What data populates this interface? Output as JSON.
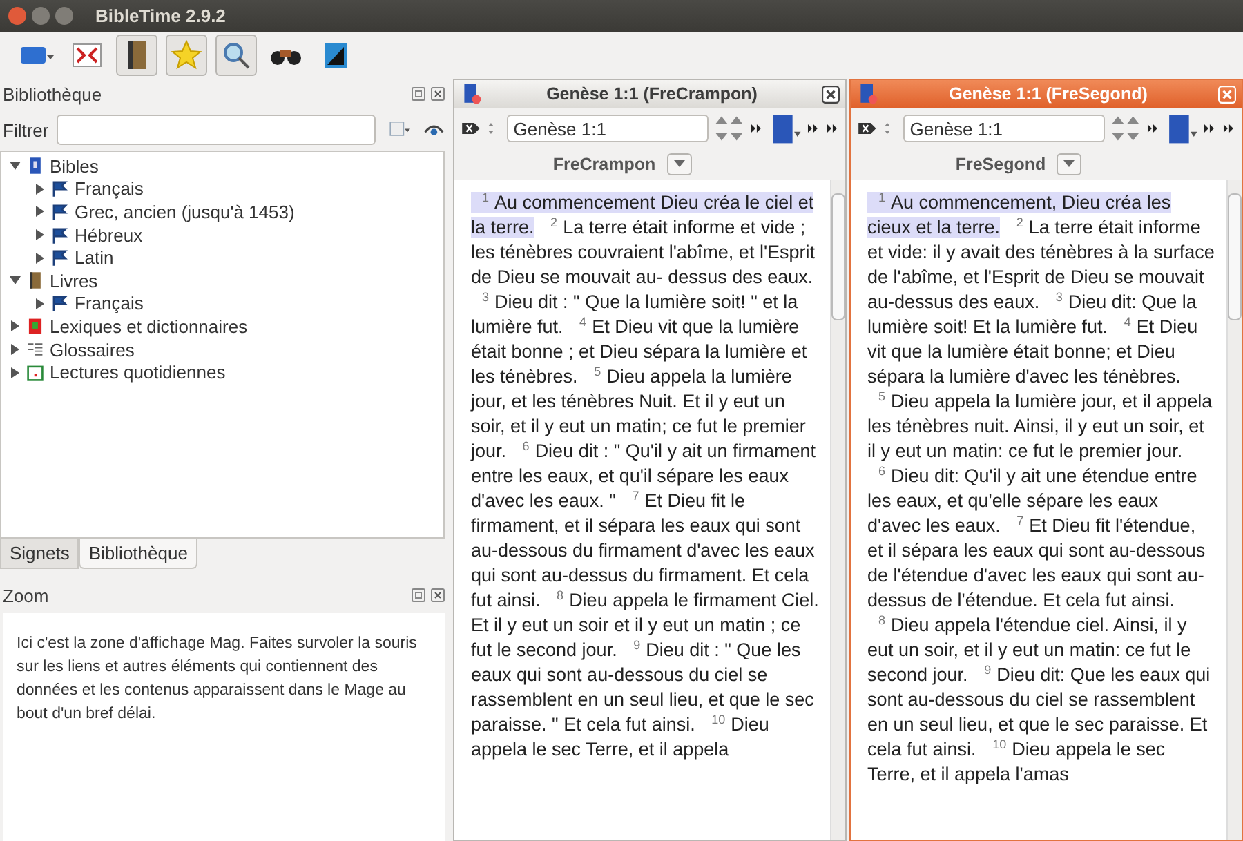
{
  "window": {
    "title": "BibleTime 2.9.2"
  },
  "library": {
    "title": "Bibliothèque",
    "filter_label": "Filtrer",
    "tree": [
      {
        "label": "Bibles",
        "kind": "bibles",
        "expanded": true,
        "children": [
          {
            "label": "Français",
            "kind": "language",
            "expanded": false
          },
          {
            "label": "Grec, ancien (jusqu'à 1453)",
            "kind": "language",
            "expanded": false
          },
          {
            "label": "Hébreux",
            "kind": "language",
            "expanded": false
          },
          {
            "label": "Latin",
            "kind": "language",
            "expanded": false
          }
        ]
      },
      {
        "label": "Livres",
        "kind": "books",
        "expanded": true,
        "children": [
          {
            "label": "Français",
            "kind": "language",
            "expanded": false
          }
        ]
      },
      {
        "label": "Lexiques et dictionnaires",
        "kind": "lexicons",
        "expanded": false
      },
      {
        "label": "Glossaires",
        "kind": "glossaries",
        "expanded": false
      },
      {
        "label": "Lectures quotidiennes",
        "kind": "devotionals",
        "expanded": false
      }
    ],
    "tabs": [
      {
        "label": "Signets",
        "selected": false
      },
      {
        "label": "Bibliothèque",
        "selected": true
      }
    ]
  },
  "zoom": {
    "title": "Zoom",
    "text": "Ici c'est la zone d'affichage Mag. Faites survoler la souris sur les liens et autres éléments qui contiennent des données et les contenus apparaissent dans le Mage au bout d'un bref délai."
  },
  "readers": [
    {
      "title": "Genèse 1:1 (FreCrampon)",
      "active": false,
      "reference": "Genèse 1:1",
      "module": "FreCrampon",
      "verses": [
        {
          "num": "1",
          "text": "Au commencement Dieu créa le ciel et la terre.",
          "selected": true
        },
        {
          "num": "2",
          "text": "La terre était informe et vide ; les ténèbres couvraient l'abîme, et l'Esprit de Dieu se mouvait au- dessus des eaux.",
          "selected": false
        },
        {
          "num": "3",
          "text": "Dieu dit : \" Que la lumière soit! \" et la lumière fut.",
          "selected": false
        },
        {
          "num": "4",
          "text": "Et Dieu vit que la lumière était bonne ; et Dieu sépara la lumière et les ténèbres.",
          "selected": false
        },
        {
          "num": "5",
          "text": "Dieu appela la lumière jour, et les ténèbres Nuit. Et il y eut un soir, et il y eut un matin; ce fut le premier jour.",
          "selected": false
        },
        {
          "num": "6",
          "text": "Dieu dit : \" Qu'il y ait un firmament entre les eaux, et qu'il sépare les eaux d'avec les eaux. \"",
          "selected": false
        },
        {
          "num": "7",
          "text": "Et Dieu fit le firmament, et il sépara les eaux qui sont au-dessous du firmament d'avec les eaux qui sont au-dessus du firmament. Et cela fut ainsi.",
          "selected": false
        },
        {
          "num": "8",
          "text": "Dieu appela le firmament Ciel. Et il y eut un soir et il y eut un matin ; ce fut le second jour.",
          "selected": false
        },
        {
          "num": "9",
          "text": "Dieu dit : \" Que les eaux qui sont au-dessous du ciel se rassemblent en un seul lieu, et que le sec paraisse. \" Et cela fut ainsi.",
          "selected": false
        },
        {
          "num": "10",
          "text": "Dieu appela le sec Terre, et il appela",
          "selected": false
        }
      ]
    },
    {
      "title": "Genèse 1:1 (FreSegond)",
      "active": true,
      "reference": "Genèse 1:1",
      "module": "FreSegond",
      "verses": [
        {
          "num": "1",
          "text": "Au commencement, Dieu créa les cieux et la terre.",
          "selected": true
        },
        {
          "num": "2",
          "text": "La terre était informe et vide: il y avait des ténèbres à la surface de l'abîme, et l'Esprit de Dieu se mouvait au-dessus des eaux.",
          "selected": false
        },
        {
          "num": "3",
          "text": "Dieu dit: Que la lumière soit! Et la lumière fut.",
          "selected": false
        },
        {
          "num": "4",
          "text": "Et Dieu vit que la lumière était bonne; et Dieu sépara la lumière d'avec les ténèbres.",
          "selected": false
        },
        {
          "num": "5",
          "text": "Dieu appela la lumière jour, et il appela les ténèbres nuit. Ainsi, il y eut un soir, et il y eut un matin: ce fut le premier jour.",
          "selected": false
        },
        {
          "num": "6",
          "text": "Dieu dit: Qu'il y ait une étendue entre les eaux, et qu'elle sépare les eaux d'avec les eaux.",
          "selected": false
        },
        {
          "num": "7",
          "text": "Et Dieu fit l'étendue, et il sépara les eaux qui sont au-dessous de l'étendue d'avec les eaux qui sont au-dessus de l'étendue. Et cela fut ainsi.",
          "selected": false
        },
        {
          "num": "8",
          "text": "Dieu appela l'étendue ciel. Ainsi, il y eut un soir, et il y eut un matin: ce fut le second jour.",
          "selected": false
        },
        {
          "num": "9",
          "text": "Dieu dit: Que les eaux qui sont au-dessous du ciel se rassemblent en un seul lieu, et que le sec paraisse. Et cela fut ainsi.",
          "selected": false
        },
        {
          "num": "10",
          "text": "Dieu appela le sec Terre, et il appela l'amas",
          "selected": false
        }
      ]
    }
  ]
}
